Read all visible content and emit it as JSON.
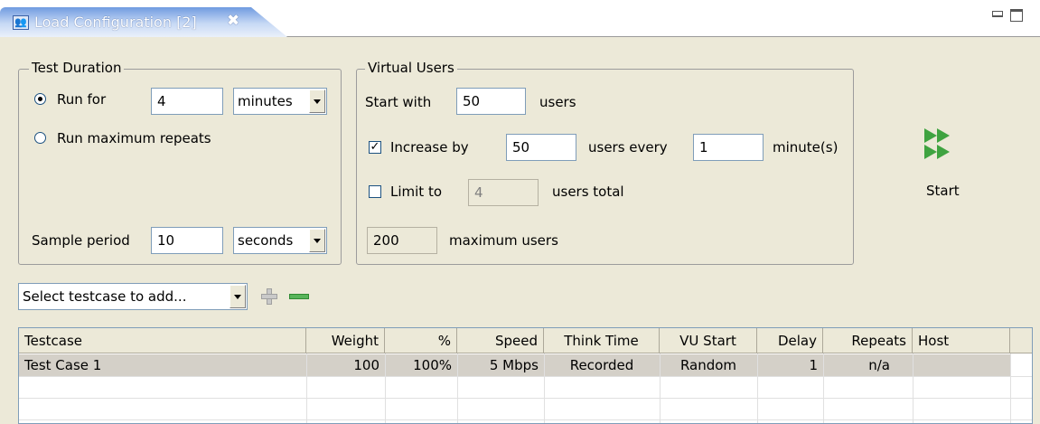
{
  "tab": {
    "title": "Load Configuration [2]",
    "close_glyph": "✖",
    "icon_glyph": "👥"
  },
  "test_duration": {
    "legend": "Test Duration",
    "run_for_label": "Run for",
    "run_for_value": "4",
    "run_for_unit": "minutes",
    "run_for_selected": true,
    "run_max_label": "Run maximum repeats",
    "sample_period_label": "Sample period",
    "sample_period_value": "10",
    "sample_period_unit": "seconds"
  },
  "virtual_users": {
    "legend": "Virtual Users",
    "start_with_label": "Start with",
    "start_with_value": "50",
    "start_users_label": "users",
    "increase_checked": true,
    "increase_label": "Increase by",
    "increase_value": "50",
    "users_every_label": "users every",
    "every_value": "1",
    "minutes_label": "minute(s)",
    "limit_checked": false,
    "limit_label": "Limit to",
    "limit_value": "4",
    "users_total_label": "users total",
    "max_users_value": "200",
    "max_users_label": "maximum users"
  },
  "start_button": {
    "label": "Start",
    "icon": "play-icon",
    "color": "#3fa340"
  },
  "testcase_select": {
    "value": "Select testcase to add...",
    "add_icon": "plus-icon",
    "remove_icon": "minus-icon"
  },
  "table": {
    "headers": [
      "Testcase",
      "Weight",
      "%",
      "Speed",
      "Think Time",
      "VU Start",
      "Delay",
      "Repeats",
      "Host"
    ],
    "rows": [
      {
        "testcase": "Test Case 1",
        "weight": "100",
        "percent": "100%",
        "speed": "5 Mbps",
        "think_time": "Recorded",
        "vu_start": "Random",
        "delay": "1",
        "repeats": "n/a",
        "host": ""
      }
    ]
  }
}
